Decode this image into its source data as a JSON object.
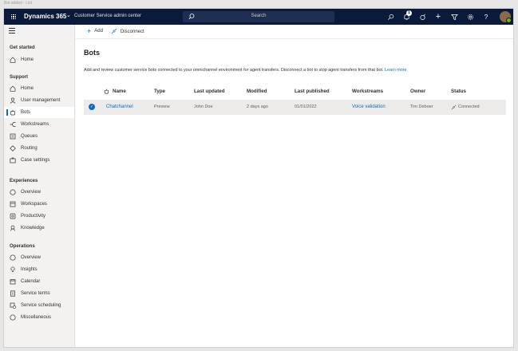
{
  "window": {
    "caption": "Bot added - List"
  },
  "topbar": {
    "app_name": "Dynamics 365",
    "area_name": "Customer Service admin center",
    "search_placeholder": "Search",
    "notification_count": "1",
    "help_icon_label": "?"
  },
  "commands": {
    "add": "Add",
    "disconnect": "Disconnect"
  },
  "page": {
    "title": "Bots",
    "description": "Add and review customer service bots connected to your omnichannel environment for agent transfers. Disconnect a bot to stop agent transfers from that bot.",
    "learn_more": "Learn more"
  },
  "sidebar": {
    "sections": {
      "get_started": "Get started",
      "support": "Support",
      "experiences": "Experiences",
      "operations": "Operations"
    },
    "items": {
      "gs_home": "Home",
      "home": "Home",
      "user_management": "User management",
      "bots": "Bots",
      "workstreams": "Workstreams",
      "queues": "Queues",
      "routing": "Routing",
      "case_settings": "Case settings",
      "exp_overview": "Overview",
      "workspaces": "Workspaces",
      "productivity": "Productivity",
      "knowledge": "Knowledge",
      "ops_overview": "Overview",
      "insights": "Insights",
      "calendar": "Calendar",
      "service_terms": "Service terms",
      "service_scheduling": "Service scheduling",
      "miscellaneous": "Miscellaneous"
    }
  },
  "table": {
    "columns": {
      "name": "Name",
      "type": "Type",
      "last_updated": "Last updated",
      "modified": "Modified",
      "last_published": "Last published",
      "workstreams": "Workstreams",
      "owner": "Owner",
      "status": "Status"
    },
    "rows": [
      {
        "name": "Chatchannel",
        "type": "Preview",
        "last_updated": "John Doe",
        "modified": "2 days ago",
        "last_published": "01/01/2022",
        "workstreams": "Voice validation",
        "owner": "Tim Deboer",
        "status": "Connected",
        "selected": true
      }
    ]
  },
  "colors": {
    "topbar": "#0a1a3a",
    "accent": "#0f6cbd",
    "selected_row": "#edebe9"
  }
}
